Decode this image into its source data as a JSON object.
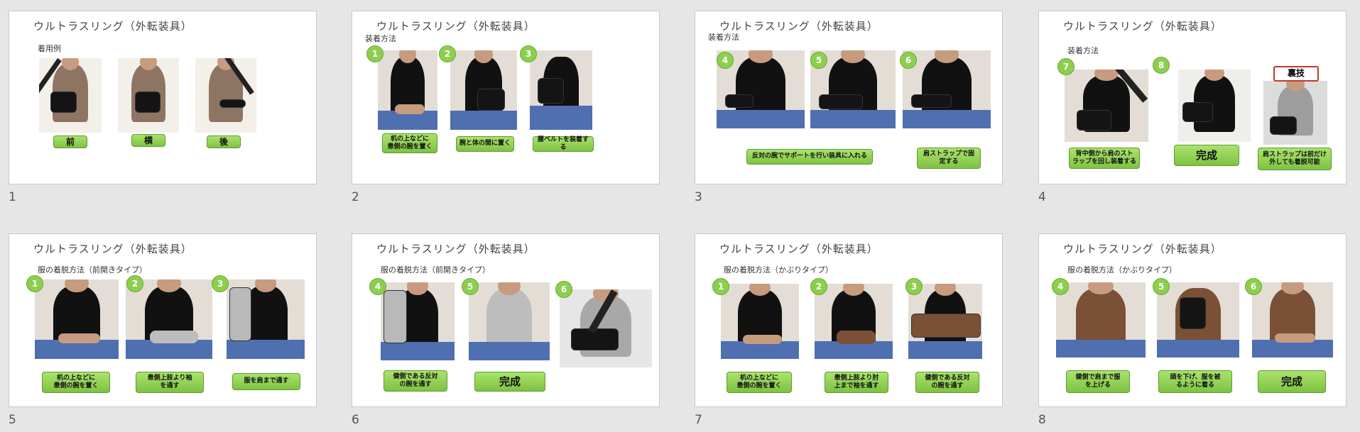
{
  "slides": [
    {
      "num": "1",
      "title": "ウルトラスリング（外転装具）",
      "subtitle": "着用例",
      "captions": [
        "前",
        "横",
        "後"
      ],
      "badges": []
    },
    {
      "num": "2",
      "title": "ウルトラスリング（外転装具）",
      "subtitle": "装着方法",
      "captions": [
        "机の上などに\n患側の腕を置く",
        "腕と体の間に置く",
        "腰ベルトを装着する"
      ],
      "badges": [
        "1",
        "2",
        "3"
      ]
    },
    {
      "num": "3",
      "title": "ウルトラスリング（外転装具）",
      "subtitle": "装着方法",
      "captions": [
        "反対の腕でサポートを行い装具に入れる",
        "肩ストラップで固\n定する"
      ],
      "badges": [
        "4",
        "5",
        "6"
      ]
    },
    {
      "num": "4",
      "title": "ウルトラスリング（外転装具）",
      "subtitle": "装着方法",
      "captions": [
        "背中側から肩のスト\nラップを回し装着する",
        "完成",
        "肩ストラップは前だけ\n外しても着脱可能"
      ],
      "badges": [
        "7",
        "8"
      ],
      "extra": "裏技"
    },
    {
      "num": "5",
      "title": "ウルトラスリング（外転装具）",
      "subtitle": "服の着脱方法（前開きタイプ）",
      "captions": [
        "机の上などに\n患側の腕を置く",
        "患側上肢より袖\nを通す",
        "服を肩まで通す"
      ],
      "badges": [
        "1",
        "2",
        "3"
      ]
    },
    {
      "num": "6",
      "title": "ウルトラスリング（外転装具）",
      "subtitle": "服の着脱方法（前開きタイプ）",
      "captions": [
        "健側である反対\nの腕を通す",
        "完成"
      ],
      "badges": [
        "4",
        "5",
        "6"
      ]
    },
    {
      "num": "7",
      "title": "ウルトラスリング（外転装具）",
      "subtitle": "服の着脱方法（かぶりタイプ）",
      "captions": [
        "机の上などに\n患側の腕を置く",
        "患側上肢より肘\n上まで袖を通す",
        "健側である反対\nの腕を通す"
      ],
      "badges": [
        "1",
        "2",
        "3"
      ]
    },
    {
      "num": "8",
      "title": "ウルトラスリング（外転装具）",
      "subtitle": "服の着脱方法（かぶりタイプ）",
      "captions": [
        "健側で肩まで服\nを上げる",
        "頭を下げ、服を被\nるように着る",
        "完成"
      ],
      "badges": [
        "4",
        "5",
        "6"
      ]
    }
  ],
  "colors": {
    "badge": "#8ccf4e",
    "caption": "#8fd14f",
    "table": "#4f6fb0",
    "shirt": "#111111",
    "accent_red": "#c0392b"
  }
}
